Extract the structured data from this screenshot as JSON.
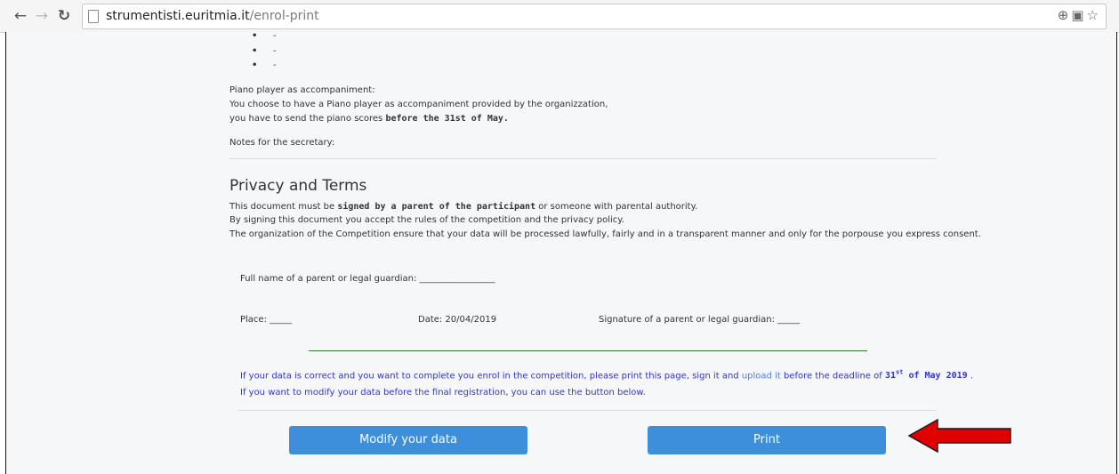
{
  "browser": {
    "url_host": "strumentisti.euritmia.it",
    "url_path": "/enrol-print",
    "icons": [
      "back-icon",
      "forward-icon",
      "reload-icon",
      "page-icon",
      "zoom-icon",
      "translate-icon",
      "bookmark-star-icon"
    ]
  },
  "list_items": [
    "-",
    "-",
    "-"
  ],
  "piano": {
    "heading": "Piano player as accompaniment:",
    "line1": "You choose to have a Piano player as accompaniment provided by the organizzation,",
    "line2_prefix": "you have to send the piano scores ",
    "line2_bold": "before the 31st of May."
  },
  "notes_label": "Notes for the secretary:",
  "privacy": {
    "title": "Privacy and Terms",
    "line1_prefix": "This document must be ",
    "line1_bold": "signed by a parent of the participant",
    "line1_suffix": " or someone with parental authority.",
    "line2": "By signing this document you accept the rules of the competition and the privacy policy.",
    "line3": "The organization of the Competition ensure that your data will be processed lawfully, fairly and in a transparent manner and only for the porpouse you express consent."
  },
  "form": {
    "guardian_name": "Full name of a parent or legal guardian: _________________",
    "place": "Place: _____",
    "date": "Date: 20/04/2019",
    "signature": "Signature of a parent or legal guardian: _____"
  },
  "instructions": {
    "line1_prefix": "If your data is correct and you want to complete you enrol in the competition, please print this page, sign it and ",
    "line1_link": "upload it",
    "line1_middle": " before the deadline of ",
    "deadline_day": "31",
    "deadline_sup": "st",
    "deadline_rest": " of May 2019",
    "line1_end": " .",
    "line2": "If you want to modify your data before the final registration, you can use the button below."
  },
  "buttons": {
    "modify": "Modify your data",
    "print": "Print"
  },
  "colors": {
    "button_blue": "#3d8fdc",
    "annotation_arrow": "#e00000"
  }
}
